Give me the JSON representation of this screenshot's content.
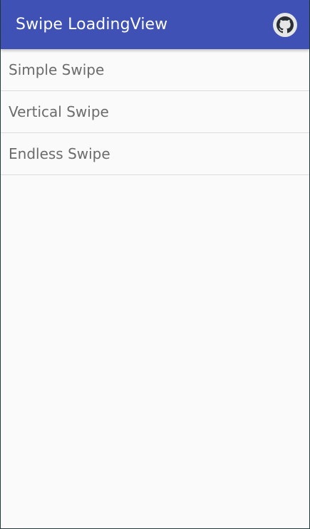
{
  "app_bar": {
    "title": "Swipe LoadingView",
    "background_color": "#3f51b5",
    "action_icon": "github-icon"
  },
  "list": {
    "items": [
      {
        "label": "Simple Swipe"
      },
      {
        "label": "Vertical Swipe"
      },
      {
        "label": "Endless Swipe"
      }
    ]
  }
}
